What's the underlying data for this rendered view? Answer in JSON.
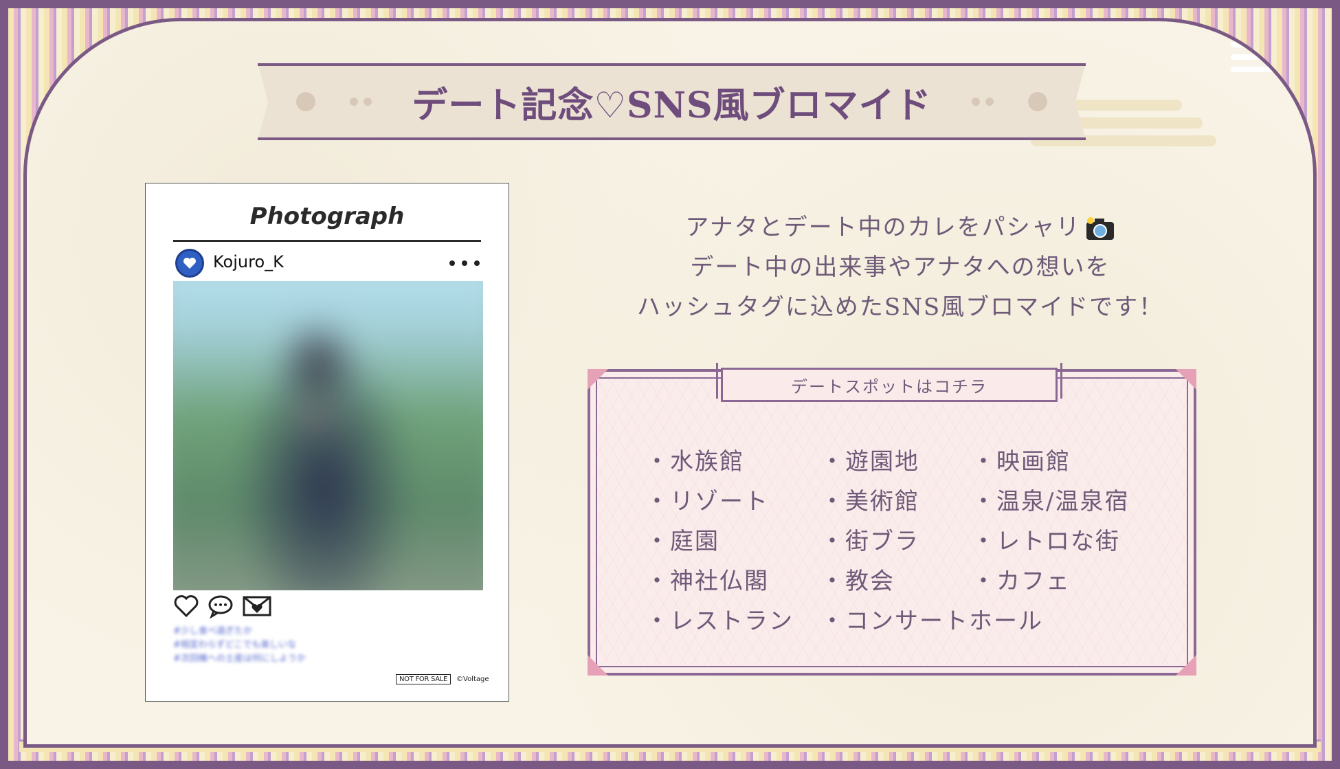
{
  "banner": {
    "title": "デート記念♡SNS風ブロマイド"
  },
  "card": {
    "brand": "Photograph",
    "username": "Kojuro_K",
    "caption_lines": [
      "#少し食べ過ぎたか",
      "#相変わらずどこでも楽しいな",
      "#次回機への土産は何にしようか"
    ],
    "not_for_sale": "NOT FOR SALE",
    "copyright": "©Voltage"
  },
  "description": {
    "line1": "アナタとデート中のカレをパシャリ",
    "line2": "デート中の出来事やアナタへの想いを",
    "line3": "ハッシュタグに込めたSNS風ブロマイドです！"
  },
  "spots": {
    "heading": "デートスポットはコチラ",
    "items": [
      "・水族館",
      "・遊園地",
      "・映画館",
      "・リゾート",
      "・美術館",
      "・温泉/温泉宿",
      "・庭園",
      "・街ブラ",
      "・レトロな街",
      "・神社仏閣",
      "・教会",
      "・カフェ",
      "・レストラン",
      "・コンサートホール"
    ]
  },
  "colors": {
    "frame": "#7a5a85",
    "text": "#6e5a78",
    "paper": "#f8f3e6",
    "spot_bg": "#fbecec"
  },
  "icons": [
    "heart-icon",
    "speech-bubble-icon",
    "envelope-heart-icon",
    "more-dots-icon",
    "camera-icon",
    "avatar-heart-icon"
  ]
}
